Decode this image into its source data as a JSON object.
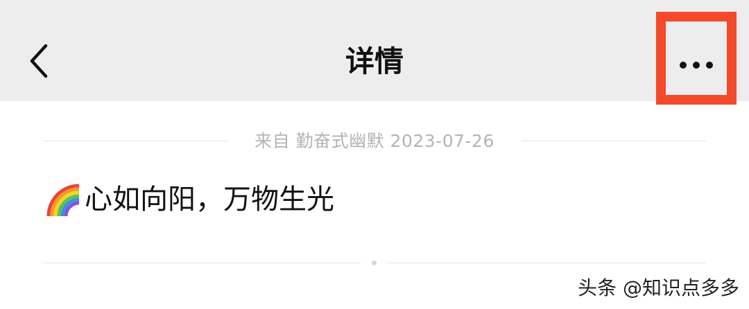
{
  "header": {
    "back_icon": "chevron-left-icon",
    "title": "详情",
    "more_icon": "more-horizontal-icon",
    "highlight_color": "#f24a2a"
  },
  "source": {
    "text": "来自 勤奋式幽默 2023-07-26"
  },
  "post": {
    "emoji_icon": "rainbow-icon",
    "text": "心如向阳，万物生光"
  },
  "watermark": {
    "text": "头条 @知识点多多"
  }
}
